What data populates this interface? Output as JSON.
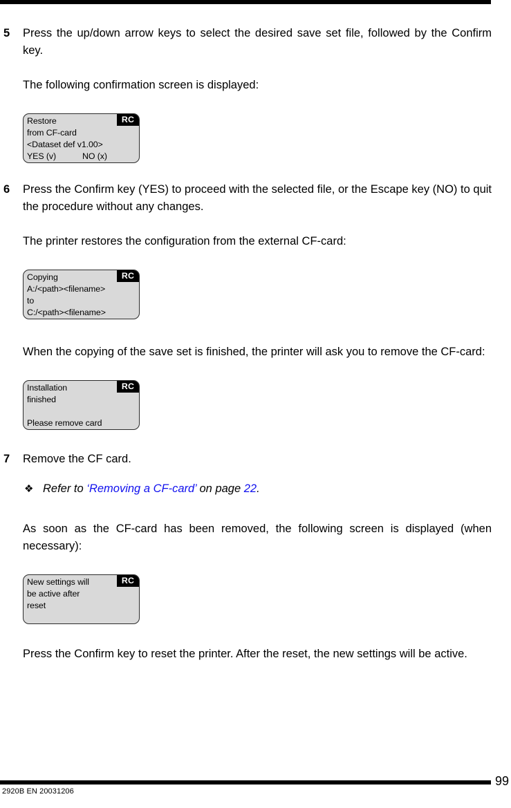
{
  "page": {
    "number": "99",
    "doc_code": "2920B EN 20031206"
  },
  "steps": [
    {
      "number": "5",
      "text": "Press the up/down arrow keys to select the desired save set file, followed by the Confirm key.",
      "follow_up": "The following confirmation screen is displayed:"
    },
    {
      "number": "6",
      "text": "Press the Confirm key (YES) to proceed with the selected file, or the Escape key (NO) to quit the procedure without any changes.",
      "follow_up": "The printer restores the configuration from the external CF-card:"
    },
    {
      "number": "7",
      "text": "Remove the CF card."
    }
  ],
  "paragraphs": {
    "after_copying": "When the copying of the save set is finished, the printer will ask you to remove the CF-card:",
    "after_removal": "As soon as the CF-card has been removed, the following screen is displayed (when necessary):",
    "final": "Press the Confirm key to reset the printer. After the reset, the new settings will be active."
  },
  "note": {
    "bullet": "❖",
    "lead": "Refer to ",
    "link": "‘Removing a CF-card’",
    "middle": " on page ",
    "page_ref": "22",
    "tail": "."
  },
  "displays": [
    {
      "name": "restore-confirmation",
      "badge": "RC",
      "line1": "Restore",
      "line2": "from CF-card",
      "line3": "<Dataset def v1.00>",
      "line4_left": "YES (v)",
      "line4_right": "NO (x)"
    },
    {
      "name": "copying-progress",
      "badge": "RC",
      "line1": "Copying",
      "line2": "A:/<path><filename>",
      "line3": "to",
      "line4": "C:/<path><filename>"
    },
    {
      "name": "installation-finished",
      "badge": "RC",
      "line1": "Installation",
      "line2": "finished",
      "line3": "",
      "line4": "Please remove card"
    },
    {
      "name": "reset-required",
      "badge": "RC",
      "line1": "New settings will",
      "line2": "be active after",
      "line3": "reset",
      "line4": ""
    }
  ],
  "colors": {
    "link": "#1010ee",
    "lcd_background": "#d9d9d9",
    "badge_background": "#000000"
  }
}
